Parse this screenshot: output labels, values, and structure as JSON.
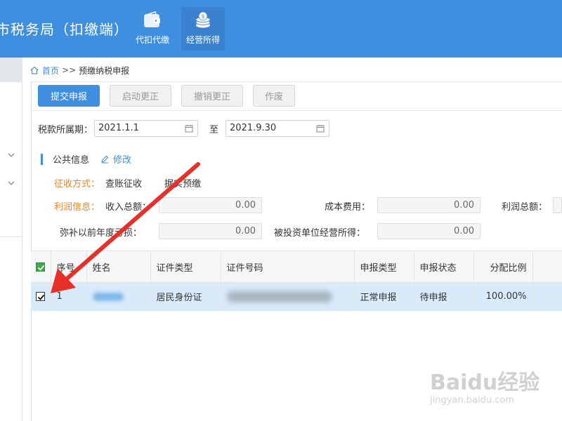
{
  "header": {
    "app_title": "市税务局（扣缴端）",
    "nav": [
      {
        "label": "代扣代缴",
        "icon": "wallet-icon"
      },
      {
        "label": "经营所得",
        "icon": "coin-stack-icon",
        "active": true
      }
    ]
  },
  "breadcrumb": {
    "home": "首页",
    "separator": ">>",
    "current": "预缴纳税申报"
  },
  "toolbar": {
    "submit": "提交申报",
    "start_correction": "启动更正",
    "cancel_correction": "撤销更正",
    "void": "作废"
  },
  "period": {
    "label": "税款所属期：",
    "start": "2021.1.1",
    "to": "至",
    "end": "2021.9.30"
  },
  "public_info": {
    "title": "公共信息",
    "edit": "修改",
    "levy_method_label": "征收方式：",
    "levy_method_value": "查账征收",
    "levy_method_extra": "据实预缴",
    "profit_info_label": "利润信息：",
    "income_total_label": "收入总额：",
    "income_total_value": "0.00",
    "cost_label": "成本费用：",
    "cost_value": "0.00",
    "profit_total_label": "利润总额：",
    "loss_label": "弥补以前年度亏损：",
    "loss_value": "0.00",
    "investee_income_label": "被投资单位经营所得：",
    "investee_income_value": "0.00"
  },
  "table": {
    "columns": [
      "序号",
      "姓名",
      "证件类型",
      "证件号码",
      "申报类型",
      "申报状态",
      "分配比例"
    ],
    "rows": [
      {
        "index": "1",
        "id_type": "居民身份证",
        "report_type": "正常申报",
        "report_status": "待申报",
        "ratio": "100.00%",
        "checked": true
      }
    ]
  },
  "watermark": {
    "brand": "Baidu经验",
    "url": "jingyan.baidu.com"
  },
  "colors": {
    "header": "#3f8fe0",
    "accent": "#3f8fe0",
    "orange_label": "#f0842a",
    "row_selected": "#d9ebfb",
    "arrow": "#e8302a"
  }
}
